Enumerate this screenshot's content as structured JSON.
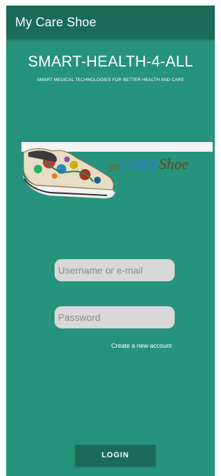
{
  "app_bar": {
    "title": "My Care Shoe"
  },
  "header": {
    "headline": "SMART-HEALTH-4-ALL",
    "tagline": "SMART MEDICAL TECHNOLOGIES FOR BETTER HEALTH AND CARE"
  },
  "banner": {
    "logo_my": "my",
    "logo_care": "CARE",
    "logo_shoe": "Shoe"
  },
  "form": {
    "username_placeholder": "Username or e-mail",
    "password_placeholder": "Password",
    "create_account_label": "Create a new account",
    "login_label": "LOGIN"
  },
  "colors": {
    "background": "#26937c",
    "app_bar": "#1a6b57",
    "input": "#d8d8d8"
  }
}
